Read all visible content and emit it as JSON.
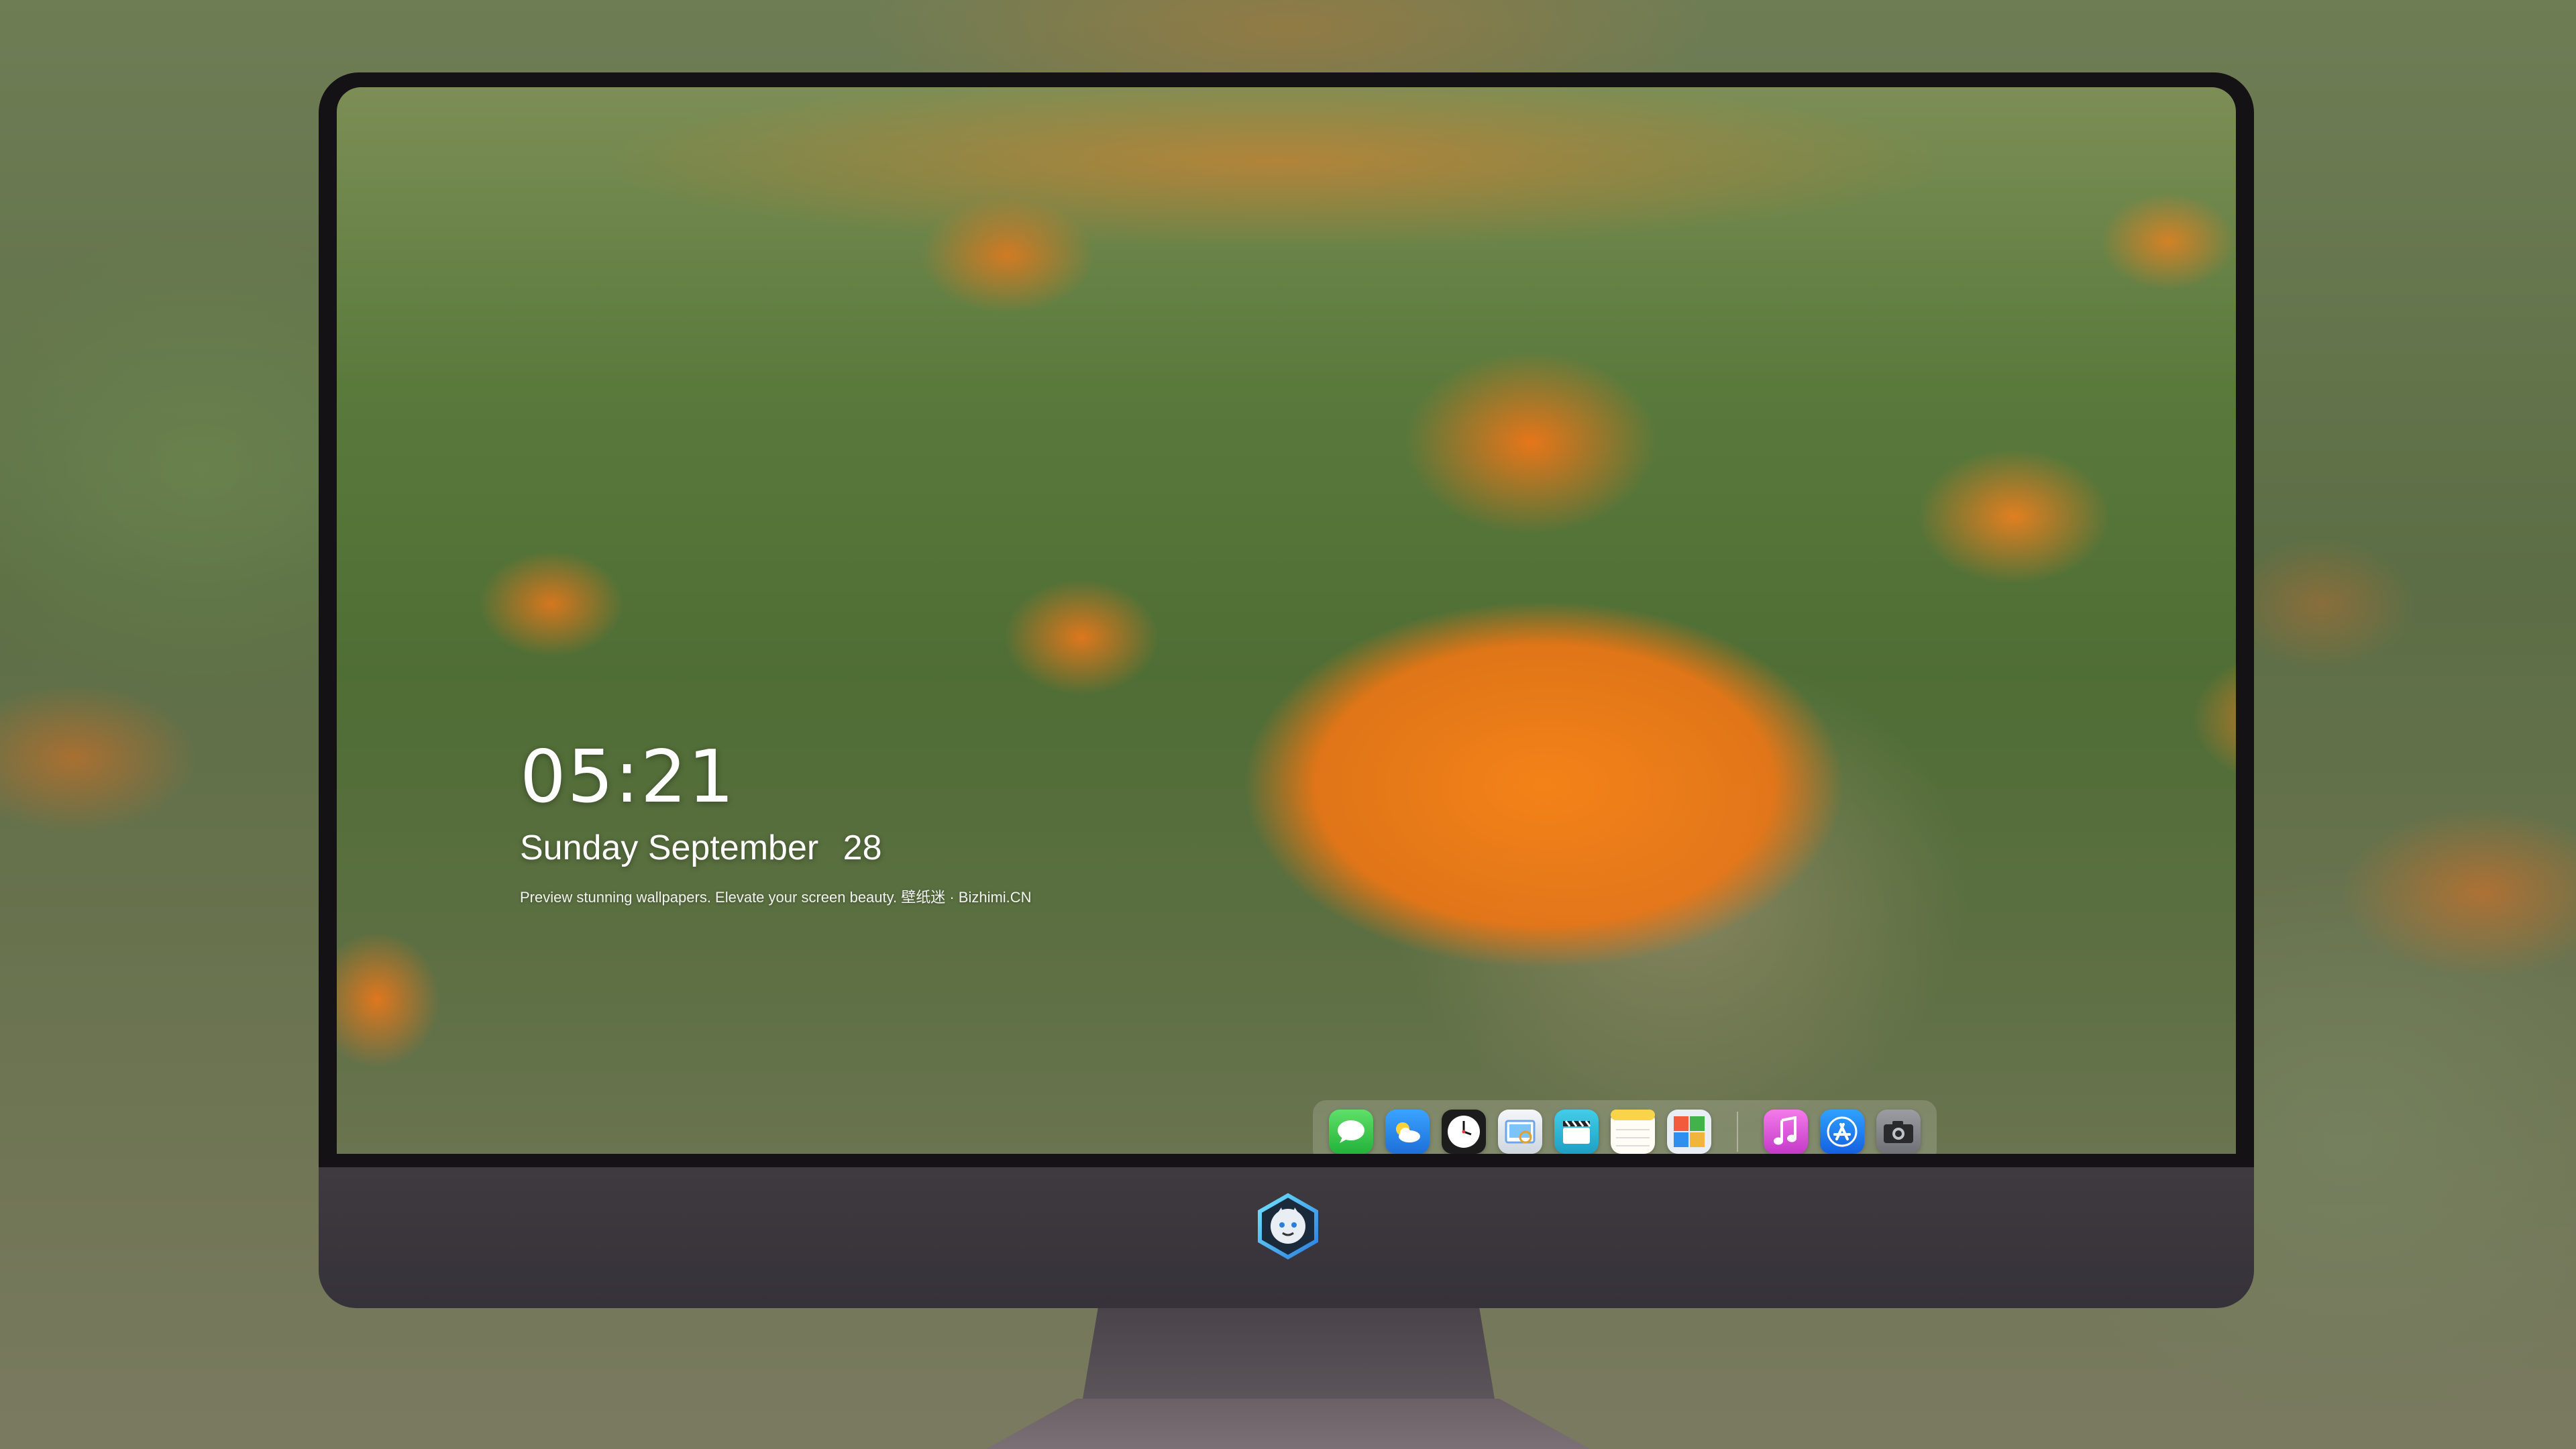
{
  "lockscreen": {
    "time": "05:21",
    "weekday": "Sunday",
    "month": "September",
    "day": "28",
    "tagline": "Preview stunning wallpapers. Elevate your screen beauty. 壁纸迷 · Bizhimi.CN"
  },
  "dock": {
    "apps_left": [
      {
        "name": "messages-icon",
        "color": "#35c64a"
      },
      {
        "name": "weather-icon",
        "color": "#2f8ff0"
      },
      {
        "name": "clock-icon",
        "color": "#1c1c1c"
      },
      {
        "name": "preview-icon",
        "color": "#e9edf2"
      },
      {
        "name": "clips-icon",
        "color": "#2cb7d8"
      },
      {
        "name": "notes-icon",
        "color": "#f7d44a"
      },
      {
        "name": "photo-booth-icon",
        "color": "#e8eef4"
      }
    ],
    "apps_right": [
      {
        "name": "music-icon",
        "color": "#e455d8"
      },
      {
        "name": "app-store-icon",
        "color": "#1d7cf2"
      },
      {
        "name": "camera-icon",
        "color": "#8a8d92"
      }
    ]
  },
  "colors": {
    "bezel": "#141214",
    "chin": "#3f3a3f",
    "accent_flower": "#f08318"
  }
}
